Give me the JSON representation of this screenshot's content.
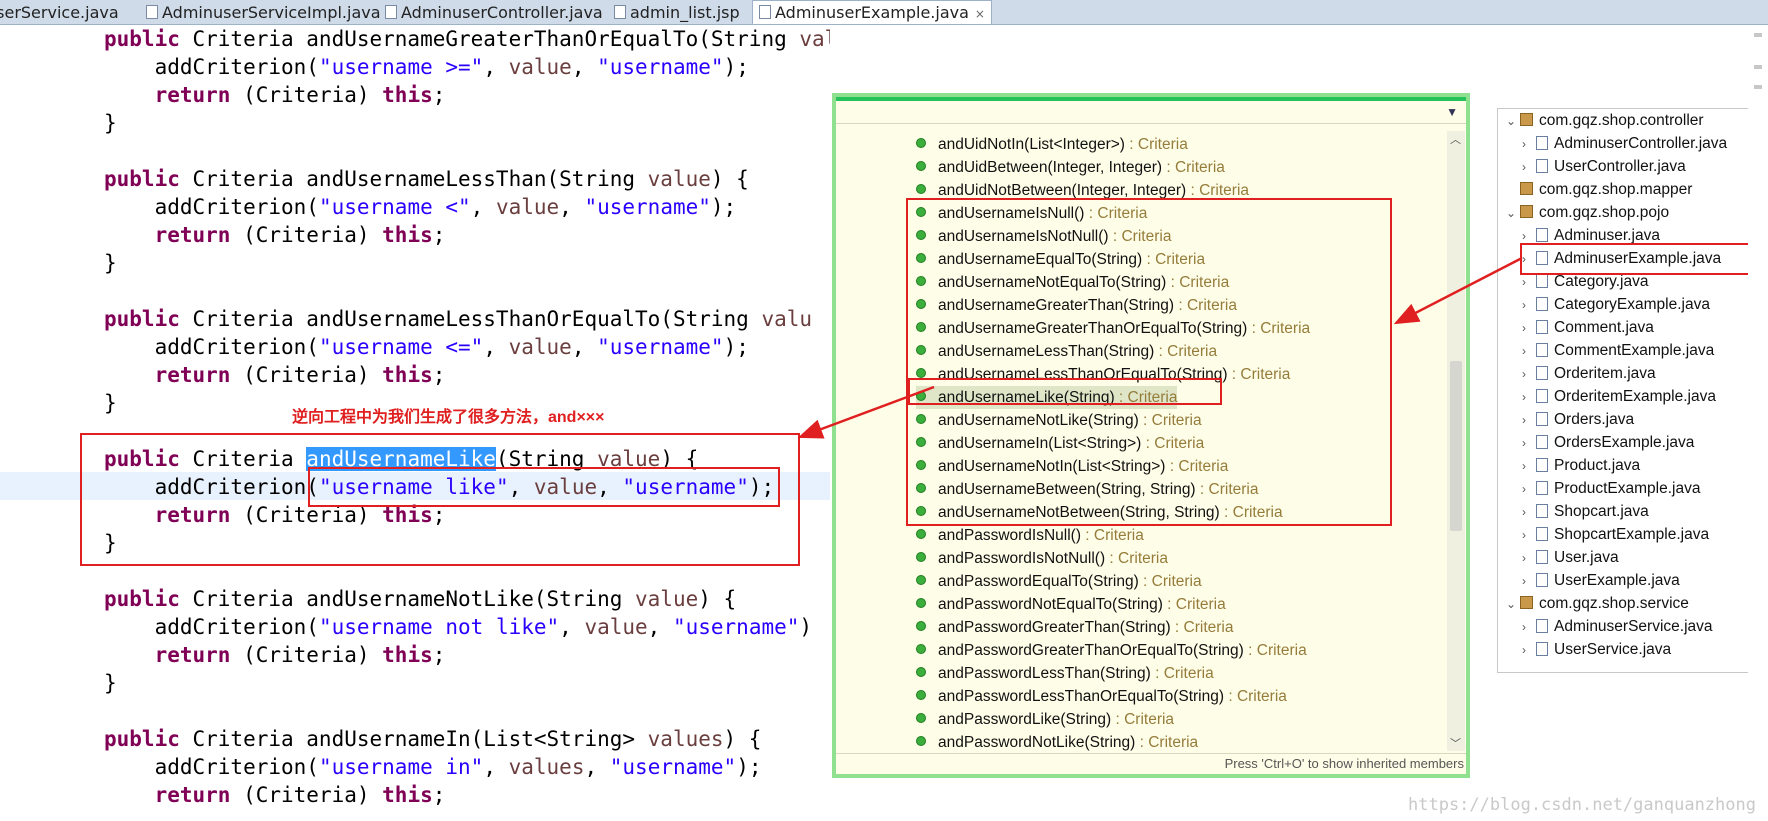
{
  "tabs": [
    {
      "label": "userService.java",
      "active": false
    },
    {
      "label": "AdminuserServiceImpl.java",
      "active": false
    },
    {
      "label": "AdminuserController.java",
      "active": false
    },
    {
      "label": "admin_list.jsp",
      "active": false
    },
    {
      "label": "AdminuserExample.java",
      "active": true,
      "close": "×"
    }
  ],
  "code": {
    "l1_kw": "public",
    "l1_rest": " Criteria andUsernameGreaterThanOrEqualTo(String ",
    "l1_var": "value",
    "l1_end": ") {",
    "l2_a": "    addCriterion(",
    "l2_s1": "\"username >=\"",
    "l2_b": ", ",
    "l2_var": "value",
    "l2_c": ", ",
    "l2_s2": "\"username\"",
    "l2_d": ");",
    "l3_kw": "    return",
    "l3_mid": " (Criteria) ",
    "l3_this": "this",
    "l3_end": ";",
    "l4": "}",
    "l5_kw": "public",
    "l5_rest": " Criteria andUsernameLessThan(String ",
    "l5_var": "value",
    "l5_end": ") {",
    "l6_a": "    addCriterion(",
    "l6_s1": "\"username <\"",
    "l6_b": ", ",
    "l6_var": "value",
    "l6_c": ", ",
    "l6_s2": "\"username\"",
    "l6_d": ");",
    "l7_kw": "    return",
    "l7_mid": " (Criteria) ",
    "l7_this": "this",
    "l7_end": ";",
    "l8": "}",
    "l9_kw": "public",
    "l9_rest": " Criteria andUsernameLessThanOrEqualTo(String ",
    "l9_var": "valu",
    "l10_a": "    addCriterion(",
    "l10_s1": "\"username <=\"",
    "l10_b": ", ",
    "l10_var": "value",
    "l10_c": ", ",
    "l10_s2": "\"username\"",
    "l10_d": ");",
    "l11_kw": "    return",
    "l11_mid": " (Criteria) ",
    "l11_this": "this",
    "l11_end": ";",
    "l12": "}",
    "l13_kw": "public",
    "l13_mid": " Criteria ",
    "l13_hl": "andUsernameLike",
    "l13_rest": "(String ",
    "l13_var": "value",
    "l13_end": ") {",
    "l14_a": "    addCriterion(",
    "l14_s1": "\"username like\"",
    "l14_b": ", ",
    "l14_var": "value",
    "l14_c": ", ",
    "l14_s2": "\"username\"",
    "l14_d": ");",
    "l15_kw": "    return",
    "l15_mid": " (Criteria) ",
    "l15_this": "this",
    "l15_end": ";",
    "l16": "}",
    "l17_kw": "public",
    "l17_rest": " Criteria andUsernameNotLike(String ",
    "l17_var": "value",
    "l17_end": ") {",
    "l18_a": "    addCriterion(",
    "l18_s1": "\"username not like\"",
    "l18_b": ", ",
    "l18_var": "value",
    "l18_c": ", ",
    "l18_s2": "\"username\"",
    "l18_d": ")",
    "l19_kw": "    return",
    "l19_mid": " (Criteria) ",
    "l19_this": "this",
    "l19_end": ";",
    "l20": "}",
    "l21_kw": "public",
    "l21_rest": " Criteria andUsernameIn(List<String> ",
    "l21_var": "values",
    "l21_end": ") {",
    "l22_a": "    addCriterion(",
    "l22_s1": "\"username in\"",
    "l22_b": ", ",
    "l22_var": "values",
    "l22_c": ", ",
    "l22_s2": "\"username\"",
    "l22_d": ");",
    "l23_kw": "    return",
    "l23_mid": " (Criteria) ",
    "l23_this": "this",
    "l23_end": ";"
  },
  "annotation": "逆向工程中为我们生成了很多方法，and×××",
  "outline": {
    "methods": [
      {
        "name": "andUidNotIn(List<Integer>)",
        "ret": " : Criteria"
      },
      {
        "name": "andUidBetween(Integer, Integer)",
        "ret": " : Criteria"
      },
      {
        "name": "andUidNotBetween(Integer, Integer)",
        "ret": " : Criteria"
      },
      {
        "name": "andUsernameIsNull()",
        "ret": " : Criteria"
      },
      {
        "name": "andUsernameIsNotNull()",
        "ret": " : Criteria"
      },
      {
        "name": "andUsernameEqualTo(String)",
        "ret": " : Criteria"
      },
      {
        "name": "andUsernameNotEqualTo(String)",
        "ret": " : Criteria"
      },
      {
        "name": "andUsernameGreaterThan(String)",
        "ret": " : Criteria"
      },
      {
        "name": "andUsernameGreaterThanOrEqualTo(String)",
        "ret": " : Criteria"
      },
      {
        "name": "andUsernameLessThan(String)",
        "ret": " : Criteria"
      },
      {
        "name": "andUsernameLessThanOrEqualTo(String)",
        "ret": " : Criteria"
      },
      {
        "name": "andUsernameLike(String)",
        "ret": " : Criteria"
      },
      {
        "name": "andUsernameNotLike(String)",
        "ret": " : Criteria"
      },
      {
        "name": "andUsernameIn(List<String>)",
        "ret": " : Criteria"
      },
      {
        "name": "andUsernameNotIn(List<String>)",
        "ret": " : Criteria"
      },
      {
        "name": "andUsernameBetween(String, String)",
        "ret": " : Criteria"
      },
      {
        "name": "andUsernameNotBetween(String, String)",
        "ret": " : Criteria"
      },
      {
        "name": "andPasswordIsNull()",
        "ret": " : Criteria"
      },
      {
        "name": "andPasswordIsNotNull()",
        "ret": " : Criteria"
      },
      {
        "name": "andPasswordEqualTo(String)",
        "ret": " : Criteria"
      },
      {
        "name": "andPasswordNotEqualTo(String)",
        "ret": " : Criteria"
      },
      {
        "name": "andPasswordGreaterThan(String)",
        "ret": " : Criteria"
      },
      {
        "name": "andPasswordGreaterThanOrEqualTo(String)",
        "ret": " : Criteria"
      },
      {
        "name": "andPasswordLessThan(String)",
        "ret": " : Criteria"
      },
      {
        "name": "andPasswordLessThanOrEqualTo(String)",
        "ret": " : Criteria"
      },
      {
        "name": "andPasswordLike(String)",
        "ret": " : Criteria"
      },
      {
        "name": "andPasswordNotLike(String)",
        "ret": " : Criteria"
      }
    ],
    "selected": "andUsernameLike(String)",
    "hint": "Press 'Ctrl+O' to show inherited members"
  },
  "explorer": {
    "items": [
      {
        "label": "com.gqz.shop.controller",
        "type": "package",
        "twisty": "⌄"
      },
      {
        "label": "AdminuserController.java",
        "type": "file",
        "twisty": "›"
      },
      {
        "label": "UserController.java",
        "type": "file",
        "twisty": "›"
      },
      {
        "label": "com.gqz.shop.mapper",
        "type": "package",
        "twisty": ""
      },
      {
        "label": "com.gqz.shop.pojo",
        "type": "package",
        "twisty": "⌄"
      },
      {
        "label": "Adminuser.java",
        "type": "file",
        "twisty": "›"
      },
      {
        "label": "AdminuserExample.java",
        "type": "file",
        "twisty": "›"
      },
      {
        "label": "Category.java",
        "type": "file",
        "twisty": "›"
      },
      {
        "label": "CategoryExample.java",
        "type": "file",
        "twisty": "›"
      },
      {
        "label": "Comment.java",
        "type": "file",
        "twisty": "›"
      },
      {
        "label": "CommentExample.java",
        "type": "file",
        "twisty": "›"
      },
      {
        "label": "Orderitem.java",
        "type": "file",
        "twisty": "›"
      },
      {
        "label": "OrderitemExample.java",
        "type": "file",
        "twisty": "›"
      },
      {
        "label": "Orders.java",
        "type": "file",
        "twisty": "›"
      },
      {
        "label": "OrdersExample.java",
        "type": "file",
        "twisty": "›"
      },
      {
        "label": "Product.java",
        "type": "file",
        "twisty": "›"
      },
      {
        "label": "ProductExample.java",
        "type": "file",
        "twisty": "›"
      },
      {
        "label": "Shopcart.java",
        "type": "file",
        "twisty": "›"
      },
      {
        "label": "ShopcartExample.java",
        "type": "file",
        "twisty": "›"
      },
      {
        "label": "User.java",
        "type": "file",
        "twisty": "›"
      },
      {
        "label": "UserExample.java",
        "type": "file",
        "twisty": "›"
      },
      {
        "label": "com.gqz.shop.service",
        "type": "package",
        "twisty": "⌄"
      },
      {
        "label": "AdminuserService.java",
        "type": "file",
        "twisty": "›"
      },
      {
        "label": "UserService.java",
        "type": "file",
        "twisty": "›"
      }
    ]
  },
  "watermark": "https://blog.csdn.net/ganquanzhong",
  "colors": {
    "annotation": "#e02020",
    "selection": "#3399ff",
    "outline_border": "#25c25a"
  },
  "icons": {
    "method": "public-method-icon",
    "package": "package-icon",
    "file": "java-file-icon"
  }
}
